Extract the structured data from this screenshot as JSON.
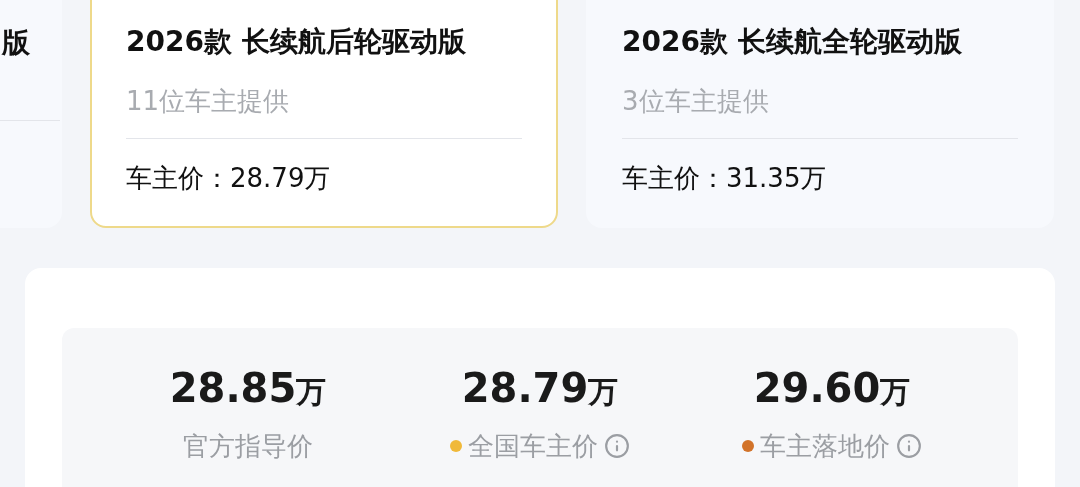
{
  "trim_cards": [
    {
      "kind": "partial",
      "title": "版",
      "selected": false
    },
    {
      "kind": "full",
      "title": "2026款 长续航后轮驱动版",
      "subtitle": "11位车主提供",
      "price": "车主价：28.79万",
      "selected": true
    },
    {
      "kind": "full",
      "title": "2026款 长续航全轮驱动版",
      "subtitle": "3位车主提供",
      "price": "车主价：31.35万",
      "selected": false
    }
  ],
  "price_summary": [
    {
      "value": "28.85",
      "unit": "万",
      "label": "官方指导价",
      "info": false
    },
    {
      "value": "28.79",
      "unit": "万",
      "label": "全国车主价",
      "color": "#f0b93a",
      "info": true
    },
    {
      "value": "29.60",
      "unit": "万",
      "label": "车主落地价",
      "color": "#d2732a",
      "info": true
    }
  ]
}
